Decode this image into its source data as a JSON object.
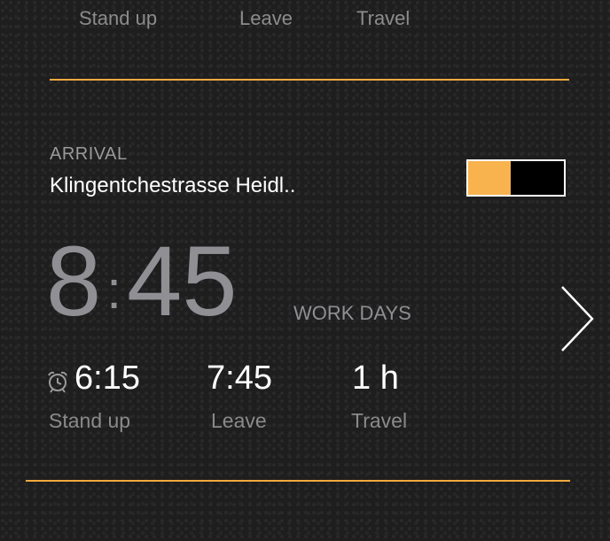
{
  "top_row": {
    "stand_up_label": "Stand up",
    "leave_label": "Leave",
    "travel_label": "Travel"
  },
  "arrival": {
    "label": "ARRIVAL",
    "address": "Klingentchestrasse Heidl..",
    "toggle_on": true
  },
  "main_time": {
    "hours": "8",
    "separator": ":",
    "minutes": "45",
    "repeat": "WORK DAYS"
  },
  "schedule": {
    "stand_up": {
      "value": "6:15",
      "label": "Stand up",
      "icon": "alarm-clock-icon"
    },
    "leave": {
      "value": "7:45",
      "label": "Leave"
    },
    "travel": {
      "value": "1 h",
      "label": "Travel"
    }
  },
  "colors": {
    "accent": "#f4a93e",
    "toggle_fill": "#f8b34f",
    "background": "#1e1e1e"
  },
  "icons": {
    "next": "chevron-right-icon",
    "alarm": "alarm-clock-icon"
  }
}
